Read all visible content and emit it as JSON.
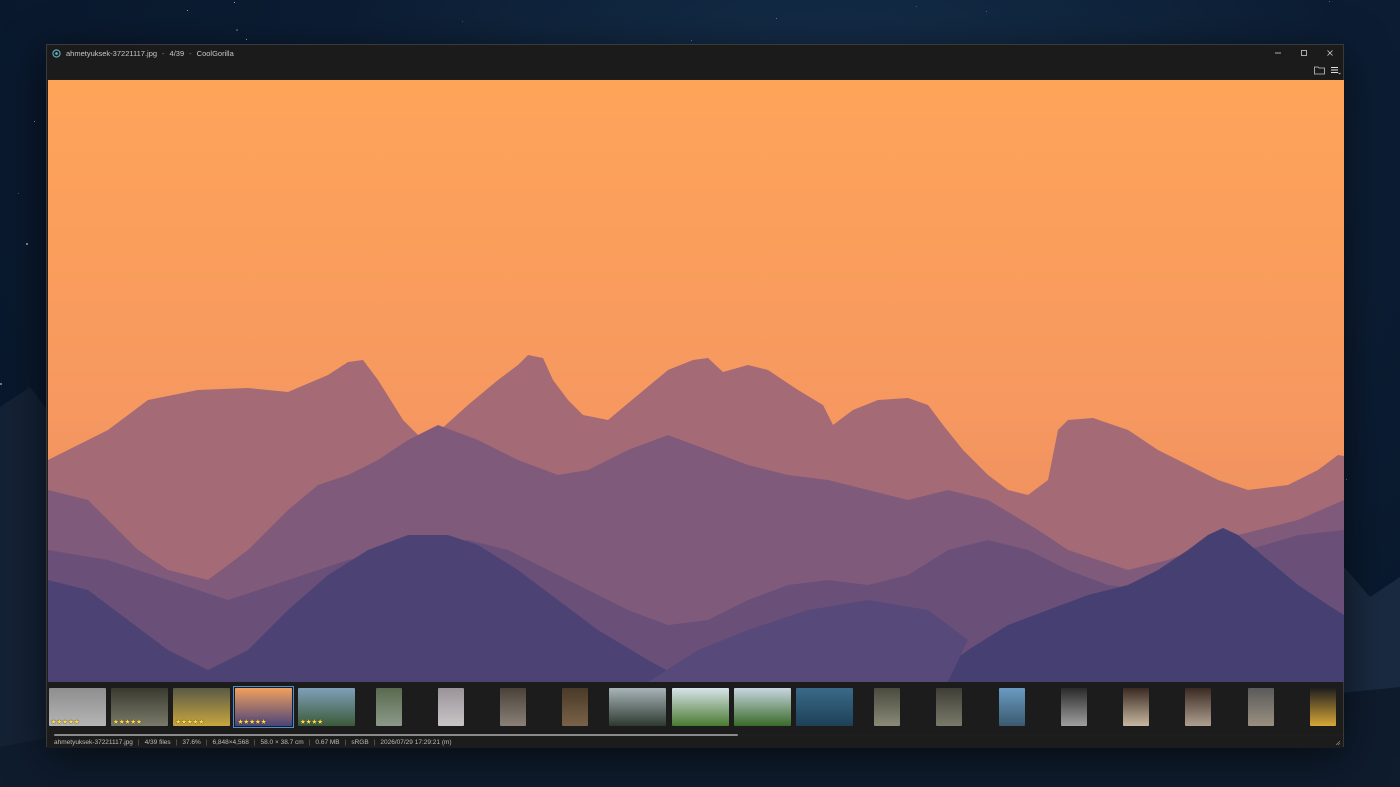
{
  "window": {
    "title_file": "ahmetyuksek-37221117.jpg",
    "title_position": "4/39",
    "app_name": "CoolGorilla",
    "separator": "-"
  },
  "window_controls": {
    "minimize_icon": "minimize-icon",
    "maximize_icon": "maximize-icon",
    "close_icon": "close-icon"
  },
  "toolbar": {
    "open_folder_icon": "folder-icon",
    "menu_icon": "hamburger-menu-icon"
  },
  "image": {
    "description_colors": {
      "sky_top": "#fea459",
      "sky_bottom": "#ec8a60",
      "far_ridge": "#a46a75",
      "mid_ridge": "#805a7a",
      "near_ridge": "#5f4c7c",
      "front_ridge": "#463f72"
    }
  },
  "filmstrip": {
    "selected_index": 3,
    "thumbnails": [
      {
        "rating": "★★★★★",
        "colors": [
          "#8e8e8e",
          "#b5b5b5"
        ]
      },
      {
        "rating": "★★★★★",
        "colors": [
          "#3a3a30",
          "#7a7a6a"
        ]
      },
      {
        "rating": "★★★★★",
        "colors": [
          "#5a5a45",
          "#c8a640"
        ]
      },
      {
        "rating": "★★★★★",
        "colors": [
          "#f2a05e",
          "#4c4478"
        ]
      },
      {
        "rating": "★★★★",
        "colors": [
          "#7ea0b8",
          "#3c5a3a"
        ]
      },
      {
        "rating": "",
        "colors": [
          "#5a6a50",
          "#8a9a88"
        ]
      },
      {
        "rating": "",
        "colors": [
          "#9a9498",
          "#c9c5c7"
        ]
      },
      {
        "rating": "",
        "colors": [
          "#4a4238",
          "#8a8078"
        ]
      },
      {
        "rating": "",
        "colors": [
          "#4a3a28",
          "#7a6248"
        ]
      },
      {
        "rating": "",
        "colors": [
          "#a8b4b8",
          "#2e3a30"
        ]
      },
      {
        "rating": "",
        "colors": [
          "#d8e4ea",
          "#4a7a30"
        ]
      },
      {
        "rating": "",
        "colors": [
          "#c8d6e0",
          "#3a6a2a"
        ]
      },
      {
        "rating": "",
        "colors": [
          "#3a6a88",
          "#1e4058"
        ]
      },
      {
        "rating": "",
        "colors": [
          "#4a4a3e",
          "#8a8a78"
        ]
      },
      {
        "rating": "",
        "colors": [
          "#3e3e36",
          "#7a7a6a"
        ]
      },
      {
        "rating": "",
        "colors": [
          "#6a9ac0",
          "#3a5a70"
        ]
      },
      {
        "rating": "",
        "colors": [
          "#2a2a2a",
          "#a0a0a0"
        ]
      },
      {
        "rating": "",
        "colors": [
          "#3a2a22",
          "#c8b8a0"
        ]
      },
      {
        "rating": "",
        "colors": [
          "#3a2a22",
          "#b0a090"
        ]
      },
      {
        "rating": "",
        "colors": [
          "#5a5a5a",
          "#9a9080"
        ]
      },
      {
        "rating": "",
        "colors": [
          "#1e1e1e",
          "#d8a838"
        ]
      }
    ]
  },
  "statusbar": {
    "filename": "ahmetyuksek-37221117.jpg",
    "files": "4/39 files",
    "zoom": "37.6%",
    "dimensions": "6,848×4,568",
    "print_size": "58.0 × 38.7 cm",
    "file_size": "0.67 MB",
    "color_profile": "sRGB",
    "datetime": "2026/07/29 17:29:21 (m)",
    "separator": "|"
  }
}
